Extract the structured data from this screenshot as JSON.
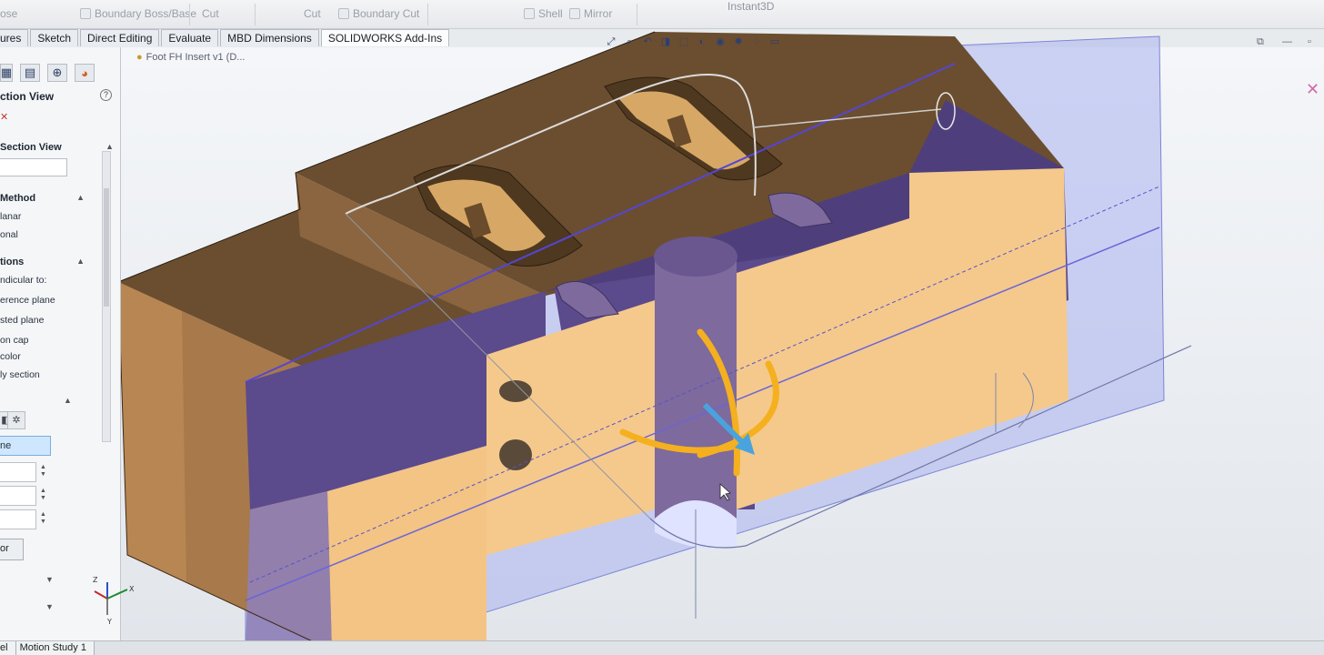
{
  "ribbon": {
    "items": [
      {
        "label": "Boundary Boss/Base"
      },
      {
        "label": "Cut"
      },
      {
        "label": "Cut"
      },
      {
        "label": "Boundary Cut"
      },
      {
        "label": "Shell"
      },
      {
        "label": "Mirror"
      },
      {
        "label": "Instant3D"
      }
    ],
    "partial_left": "ose"
  },
  "tabs": [
    {
      "label": "ures",
      "active": false
    },
    {
      "label": "Sketch",
      "active": false
    },
    {
      "label": "Direct Editing",
      "active": false
    },
    {
      "label": "Evaluate",
      "active": false
    },
    {
      "label": "MBD Dimensions",
      "active": false
    },
    {
      "label": "SOLIDWORKS Add-Ins",
      "active": true
    }
  ],
  "breadcrumb": {
    "text": "Foot FH Insert v1 (D..."
  },
  "property_manager": {
    "title": "ction View",
    "groups": {
      "section_view": "Section View",
      "method": "Method",
      "options": "tions"
    },
    "method_options": [
      "lanar",
      "onal"
    ],
    "options_items": [
      "ndicular to:",
      "erence plane",
      "sted plane",
      "on cap",
      "color",
      "ly section"
    ],
    "selected_field": "ne",
    "button": "or"
  },
  "bottom_tabs": [
    {
      "label": "el"
    },
    {
      "label": "Motion Study 1"
    }
  ],
  "colors": {
    "wood_top": "#6b4e2f",
    "wood_side": "#f2c88a",
    "section_plane": "#5b4a8c",
    "plane_tint": "#a9b3ee",
    "handle_orange": "#f4b01f",
    "arrow_blue": "#4aa3dd"
  },
  "icons": {
    "hud": [
      "zoom-to-fit-icon",
      "zoom-area-icon",
      "previous-view-icon",
      "section-view-icon",
      "view-orientation-icon",
      "display-style-icon",
      "hide-show-icon",
      "edit-appearance-icon",
      "apply-scene-icon",
      "view-settings-icon"
    ]
  }
}
